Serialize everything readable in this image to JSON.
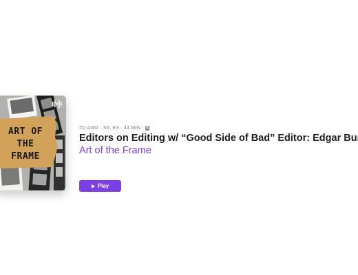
{
  "episode": {
    "meta": "2D AGO · S6, E3 · 44 MIN ·",
    "explicit_badge": "E",
    "title": "Editors on Editing w/ “Good Side of Bad” Editor: Edgar Burcksen",
    "show": "Art of the Frame"
  },
  "artwork": {
    "line1": "ART OF",
    "line2": "THE",
    "line3": "FRAME",
    "icon": "podcast-wave-icon"
  },
  "actions": {
    "play_label": "Play"
  },
  "colors": {
    "accent": "#7b3fe4",
    "title": "#1d1d1f",
    "meta": "#7a7a7a"
  }
}
